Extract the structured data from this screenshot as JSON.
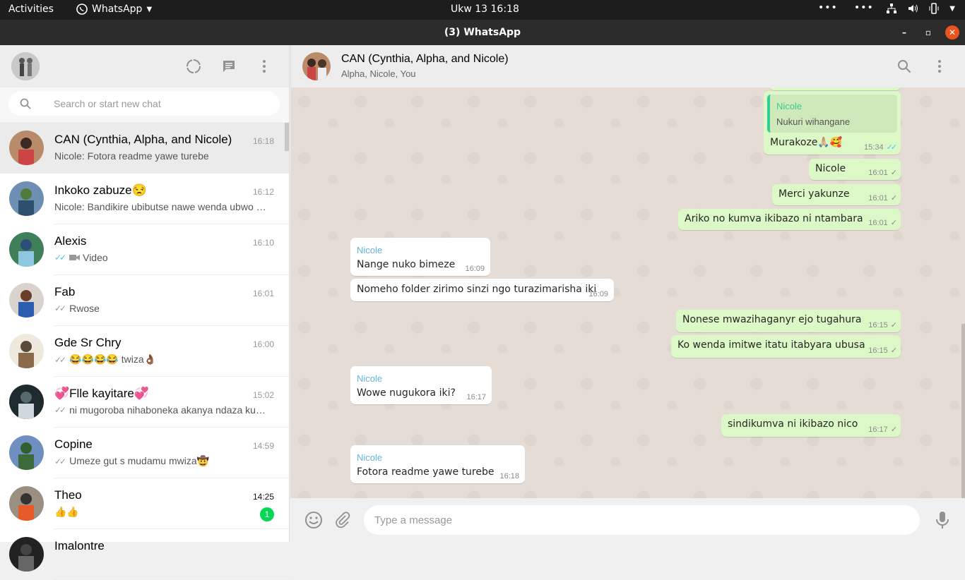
{
  "topbar": {
    "activities": "Activities",
    "app_name": "WhatsApp",
    "clock": "Ukw 13  16:18"
  },
  "window": {
    "title": "(3) WhatsApp"
  },
  "search": {
    "placeholder": "Search or start new chat"
  },
  "chats": [
    {
      "name": "CAN (Cynthia, Alpha, and Nicole)",
      "time": "16:18",
      "preview": "Nicole: Fotora readme yawe turebe",
      "ticks": "",
      "active": true
    },
    {
      "name": "Inkoko zabuze😒",
      "time": "16:12",
      "preview": "Nicole: Bandikire ubibutse nawe wenda ubwo …",
      "ticks": ""
    },
    {
      "name": "Alexis",
      "time": "16:10",
      "preview": "Video",
      "ticks": "read"
    },
    {
      "name": "Fab",
      "time": "16:01",
      "preview": "Rwose",
      "ticks": "delivered"
    },
    {
      "name": "Gde Sr Chry",
      "time": "16:00",
      "preview": "😂😂😂😂 twiza👌🏾",
      "ticks": "delivered"
    },
    {
      "name": "💞Flle kayitare💞",
      "time": "15:02",
      "preview": "ni mugoroba nihaboneka akanya ndaza ku…",
      "ticks": "delivered"
    },
    {
      "name": "Copine",
      "time": "14:59",
      "preview": "Umeze gut s mudamu mwiza🤠",
      "ticks": "delivered"
    },
    {
      "name": "Theo",
      "time": "14:25",
      "preview": "👍👍",
      "ticks": "",
      "unread": "1"
    },
    {
      "name": "Imalontre",
      "time": "",
      "preview": "",
      "ticks": ""
    }
  ],
  "conversation": {
    "name": "CAN (Cynthia, Alpha, and Nicole)",
    "members": "Alpha, Nicole, You",
    "messages": [
      {
        "dir": "out",
        "quote_sender": "Nicole",
        "quote_text": "Nukuri wihangane",
        "text": "Murakoze🙏🏼🥰",
        "time": "15:34",
        "ticks": "read"
      },
      {
        "dir": "out",
        "text": "Nicole",
        "time": "16:01",
        "ticks": "delivered"
      },
      {
        "dir": "out",
        "text": "Merci yakunze",
        "time": "16:01",
        "ticks": "delivered"
      },
      {
        "dir": "out",
        "text": "Ariko no kumva ikibazo ni ntambara",
        "time": "16:01",
        "ticks": "delivered"
      },
      {
        "dir": "in",
        "sender": "Nicole",
        "text": "Nange nuko bimeze",
        "time": "16:09"
      },
      {
        "dir": "in",
        "text": "Nomeho folder zirimo sinzi ngo turazimarisha iki",
        "time": "16:09"
      },
      {
        "dir": "out",
        "text": "Nonese mwazihaganyr ejo tugahura",
        "time": "16:15",
        "ticks": "delivered"
      },
      {
        "dir": "out",
        "text": "Ko wenda imitwe itatu itabyara ubusa",
        "time": "16:15",
        "ticks": "delivered"
      },
      {
        "dir": "in",
        "sender": "Nicole",
        "text": "Wowe nugukora iki?",
        "time": "16:17"
      },
      {
        "dir": "out",
        "text": "sindikumva ni ikibazo nico",
        "time": "16:17",
        "ticks": "delivered"
      },
      {
        "dir": "in",
        "sender": "Nicole",
        "text": "Fotora readme yawe turebe",
        "time": "16:18"
      }
    ]
  },
  "composer": {
    "placeholder": "Type a message"
  },
  "colors": {
    "outgoing": "#dcf8c6",
    "incoming": "#ffffff",
    "unread_badge": "#06d755",
    "read_tick": "#4fc3f7",
    "chat_bg": "#e5ddd5"
  },
  "icons": [
    "status-icon",
    "new-chat-icon",
    "menu-icon",
    "search-icon",
    "emoji-icon",
    "attach-icon",
    "mic-icon"
  ]
}
